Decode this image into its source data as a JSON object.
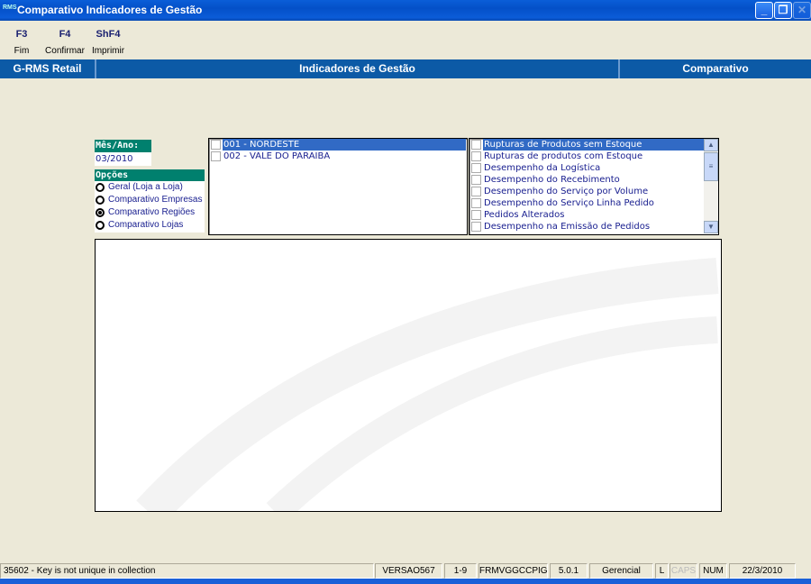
{
  "window": {
    "title": "Comparativo Indicadores de Gestão",
    "app_icon": "RMS",
    "buttons": {
      "minimize": "_",
      "restore": "❐",
      "close": "✕"
    }
  },
  "toolbar": [
    {
      "key": "F3",
      "label": "Fim"
    },
    {
      "key": "F4",
      "label": "Confirmar"
    },
    {
      "key": "ShF4",
      "label": "Imprimir"
    }
  ],
  "header": {
    "left": "G-RMS Retail",
    "center": "Indicadores de Gestão",
    "right": "Comparativo"
  },
  "period": {
    "label": "Mês/Ano:",
    "value": "03/2010"
  },
  "options": {
    "label": "Opções",
    "items": [
      {
        "label": "Geral (Loja a Loja)",
        "selected": false
      },
      {
        "label": "Comparativo Empresas",
        "selected": false
      },
      {
        "label": "Comparativo Regiões",
        "selected": true
      },
      {
        "label": "Comparativo Lojas",
        "selected": false
      }
    ]
  },
  "regions": [
    {
      "label": "001 - NORDESTE",
      "selected": true
    },
    {
      "label": "002 - VALE DO PARAIBA",
      "selected": false
    }
  ],
  "indicators": [
    {
      "label": "Rupturas de Produtos sem Estoque",
      "selected": true
    },
    {
      "label": "Rupturas de produtos com Estoque"
    },
    {
      "label": "Desempenho da Logística"
    },
    {
      "label": "Desempenho do Recebimento"
    },
    {
      "label": "Desempenho do Serviço por Volume"
    },
    {
      "label": "Desempenho do Serviço Linha Pedido"
    },
    {
      "label": "Pedidos Alterados"
    },
    {
      "label": "Desempenho na Emissão de Pedidos"
    }
  ],
  "status": {
    "message": "35602 - Key is not unique in collection",
    "version": "VERSAO567",
    "range": "1-9",
    "form": "FRMVGGCCPIG",
    "build": "5.0.1",
    "profile": "Gerencial",
    "l": "L",
    "caps": "CAPS",
    "num": "NUM",
    "date": "22/3/2010"
  }
}
